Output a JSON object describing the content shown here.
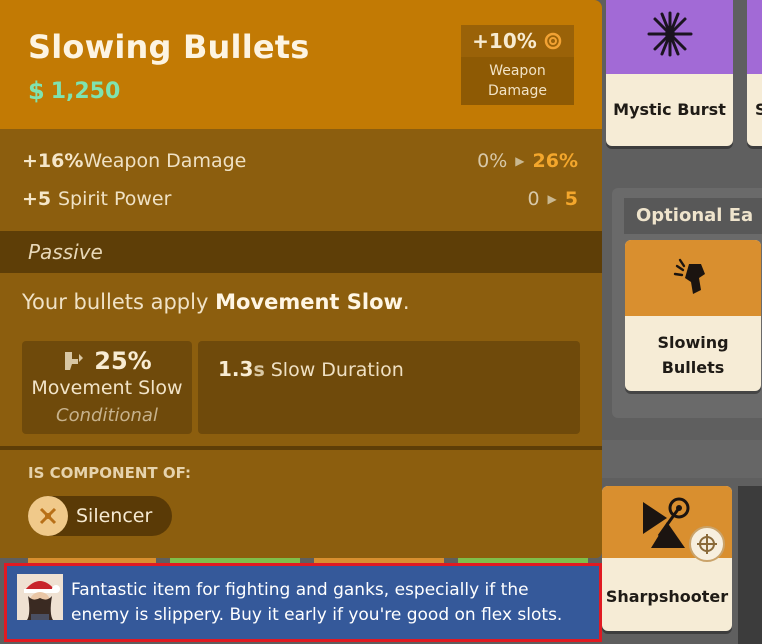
{
  "tooltip": {
    "title": "Slowing Bullets",
    "price": "1,250",
    "price_icon": "souls-currency-icon",
    "badge": {
      "value": "+10%",
      "label_line1": "Weapon",
      "label_line2": "Damage"
    },
    "stats": [
      {
        "value": "+16%",
        "name": "Weapon Damage",
        "from": "0%",
        "to": "26%"
      },
      {
        "value": "+5",
        "name": "Spirit Power",
        "from": "0",
        "to": "5"
      }
    ],
    "section": "Passive",
    "description": {
      "prefix": "Your bullets apply ",
      "highlight": "Movement Slow",
      "suffix": "."
    },
    "slow_box": {
      "value": "25%",
      "label": "Movement Slow",
      "condition": "Conditional"
    },
    "duration_box": {
      "value": "1.3",
      "unit": "s",
      "label": "Slow Duration"
    },
    "component_title": "IS COMPONENT OF:",
    "component": {
      "name": "Silencer"
    }
  },
  "shop": {
    "mystic": "Mystic Burst",
    "partial_letter": "S",
    "optional_title": "Optional Ea",
    "slowing_line1": "Slowing",
    "slowing_line2": "Bullets",
    "sharpshooter": "Sharpshooter"
  },
  "tip": {
    "text": "Fantastic item for fighting and ganks, especially if the enemy is slippery. Buy it early if you're good on flex slots."
  },
  "colors": {
    "header": "#c27a04",
    "body": "#8c5e0e",
    "price": "#7fe3b0",
    "highlight": "#f4a72c",
    "spirit_card": "#a26ad6",
    "weapon_card": "#d98f2f",
    "tip_bg": "#35599a",
    "tip_border": "#e01a22"
  }
}
